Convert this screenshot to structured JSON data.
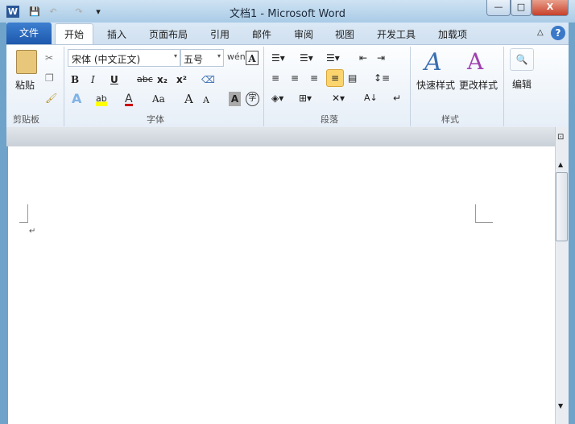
{
  "window": {
    "title": "文档1 - Microsoft Word",
    "minimize": "—",
    "maximize": "□",
    "close": "X"
  },
  "quick_access": {
    "app_icon": "W",
    "save": "💾",
    "undo": "↶",
    "redo": "↷",
    "customize": "▾"
  },
  "tabs": {
    "file": "文件",
    "items": [
      "开始",
      "插入",
      "页面布局",
      "引用",
      "邮件",
      "审阅",
      "视图",
      "开发工具",
      "加载项"
    ],
    "collapse": "△",
    "help": "?"
  },
  "clipboard": {
    "paste": "粘贴",
    "label": "剪贴板"
  },
  "font": {
    "name": "宋体 (中文正文)",
    "size": "五号",
    "bold": "B",
    "italic": "I",
    "underline": "U",
    "strike": "abc",
    "subscript": "x₂",
    "superscript": "x²",
    "grow": "A",
    "shrink": "A",
    "case": "Aa",
    "char_shading": "A",
    "enclose": "字",
    "phonetic": "wén",
    "label": "字体"
  },
  "paragraph": {
    "label": "段落"
  },
  "styles": {
    "quick": "快速样式",
    "change": "更改样式",
    "label": "样式"
  },
  "editing": {
    "label": "编辑"
  },
  "document": {
    "para_mark": "↵"
  }
}
